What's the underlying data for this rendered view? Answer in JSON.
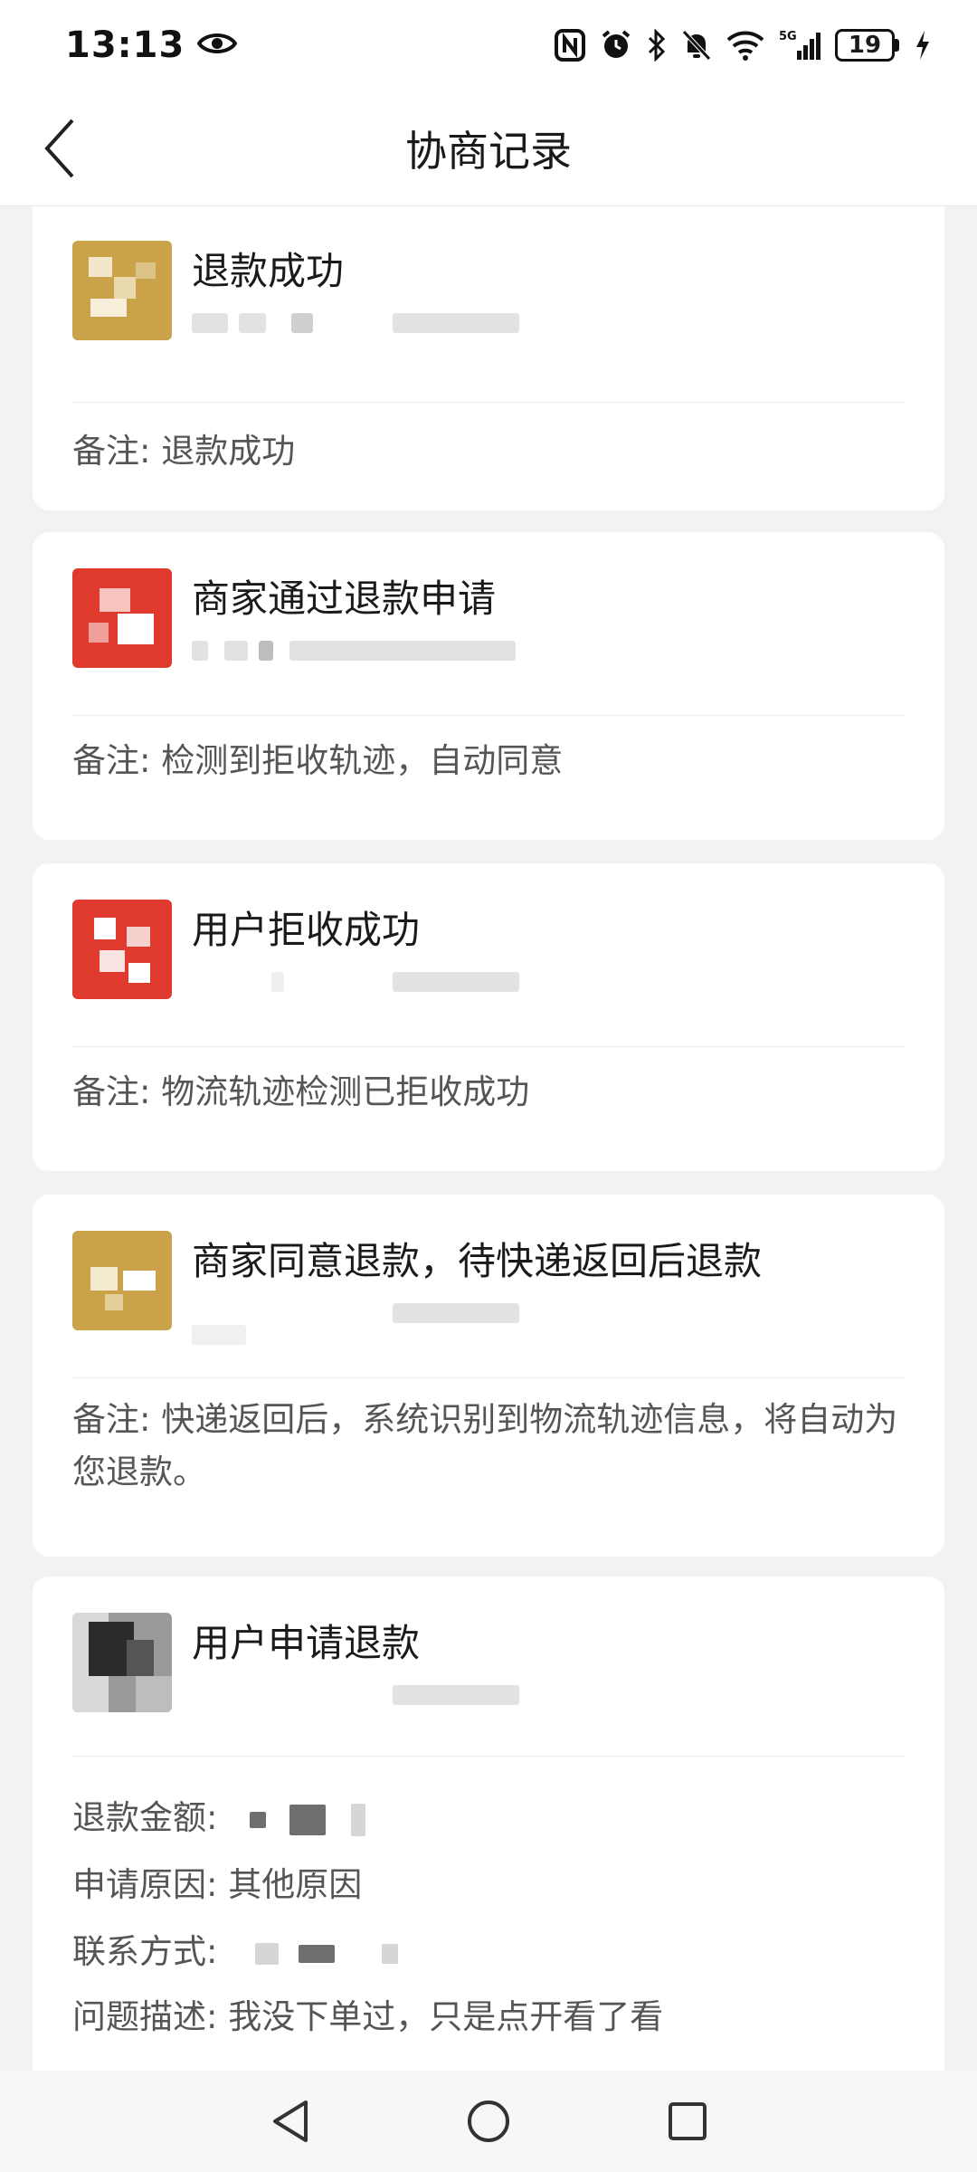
{
  "status_bar": {
    "time": "13:13",
    "battery": "19",
    "icons": [
      "eye-icon",
      "nfc-icon",
      "alarm-icon",
      "bluetooth-icon",
      "mute-icon",
      "wifi-icon",
      "signal-5g-icon",
      "charging-icon"
    ]
  },
  "header": {
    "title": "协商记录"
  },
  "records": [
    {
      "title": "退款成功",
      "remark": "备注: 退款成功"
    },
    {
      "title": "商家通过退款申请",
      "remark": "备注: 检测到拒收轨迹，自动同意"
    },
    {
      "title": "用户拒收成功",
      "remark": "备注: 物流轨迹检测已拒收成功"
    },
    {
      "title": "商家同意退款，待快递返回后退款",
      "remark": "备注: 快递返回后，系统识别到物流轨迹信息，将自动为您退款。"
    },
    {
      "title": "用户申请退款",
      "details": {
        "amount_label": "退款金额:",
        "reason": "申请原因: 其他原因",
        "contact_label": "联系方式:",
        "description": "问题描述: 我没下单过，只是点开看了看"
      }
    }
  ],
  "colors": {
    "gold": "#c9a24a",
    "red": "#e03a2f",
    "background": "#f2f2f2",
    "card": "#ffffff"
  }
}
